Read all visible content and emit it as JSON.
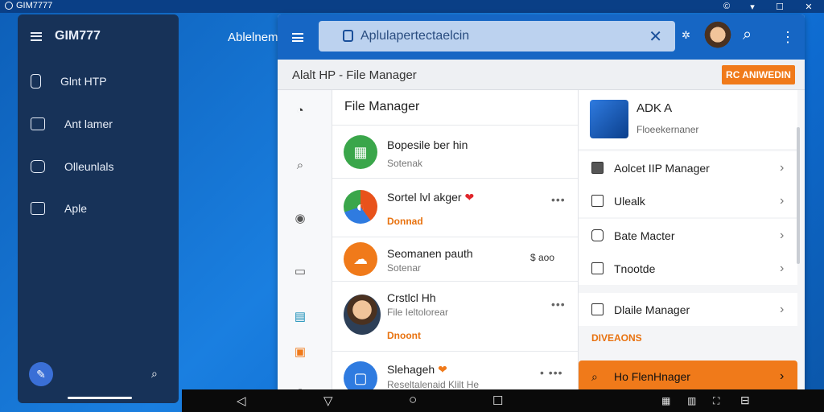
{
  "os": {
    "title": "GIM7777",
    "minimize": "▾",
    "maximize": "☐",
    "close": "✕",
    "sys": "©"
  },
  "sidebar": {
    "title": "GIM777",
    "items": [
      {
        "label": "Glnt HTP",
        "icon": "phone-icon"
      },
      {
        "label": "Ant lamer",
        "icon": "chat-icon"
      },
      {
        "label": "Olleunlals",
        "icon": "folder-icon"
      },
      {
        "label": "Aple",
        "icon": "mail-icon"
      }
    ],
    "fab_icon": "pen-icon",
    "search_icon": "search-icon"
  },
  "desktop_label": "Ablelnem",
  "appbar": {
    "search_text": "Aplulapertectaelcin",
    "search_icon": "app-icon",
    "clear": "✕",
    "search_btn": "⌕",
    "more": "⋮",
    "pin": "✲"
  },
  "titlebar": {
    "title": "Alalt HP - File Manager",
    "button": "RC ANIWEDIN"
  },
  "list": {
    "header": "File Manager",
    "rows": [
      {
        "title": "Bopesile ber hin",
        "sub": "Sotenak",
        "sub_style": "plain",
        "more": "",
        "color": "#3aa64a"
      },
      {
        "title": "Sortel lvl akger",
        "heart": "❤",
        "sub": "Donnad",
        "sub_style": "orange",
        "more": "•••",
        "color": "#e8521b"
      },
      {
        "title": "Seomanen pauth",
        "sub": "Sotenar",
        "sub_style": "plain",
        "more": "$ aoo",
        "color": "#f07a1a"
      },
      {
        "title": "Crstlcl Hh",
        "sub": "File Ieltolorear",
        "sub2": "Dnoont",
        "sub_style": "plain",
        "more": "•••",
        "color": "#3d8fd6"
      },
      {
        "title": "Slehageh",
        "heart": "❤",
        "sub": "Reseltalenaid Klilt He",
        "sub_style": "plain",
        "more": "• •••",
        "color": "#2f7be0"
      }
    ]
  },
  "panel": {
    "card": {
      "name": "ADK A",
      "subtitle": "Floeekernaner"
    },
    "items": [
      {
        "label": "Aolcet IIP Manager"
      },
      {
        "label": "Ulealk"
      },
      {
        "label": "Bate Macter"
      },
      {
        "label": "Tnootde"
      },
      {
        "label": "Dlaile Manager"
      }
    ],
    "section": "DIVEAONS",
    "highlighted": "Ho FlenHnager",
    "chevron": "›"
  },
  "navbar": {
    "back": "◁",
    "down": "▽",
    "home": "○",
    "recent": "☐"
  },
  "colors": {
    "accent": "#f07a1a",
    "appbar": "#1666c4",
    "sidebar": "#173258"
  }
}
